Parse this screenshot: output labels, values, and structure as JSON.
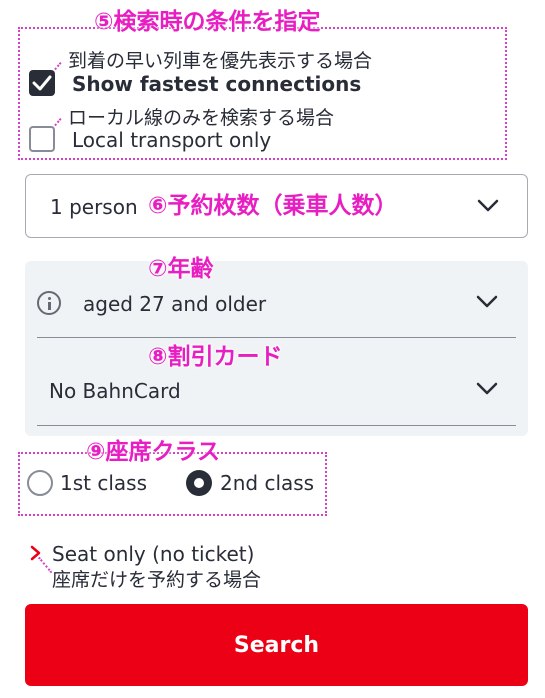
{
  "annotations": {
    "a5": "⑤検索時の条件を指定",
    "a6": "⑥予約枚数（乗車人数）",
    "a7": "⑦年齢",
    "a8": "⑧割引カード",
    "a9": "⑨座席クラス"
  },
  "options": {
    "fastest": {
      "note": "到着の早い列車を優先表示する場合",
      "label": "Show fastest connections",
      "checked": true
    },
    "local": {
      "note": "ローカル線のみを検索する場合",
      "label": "Local transport only",
      "checked": false
    }
  },
  "passengers": {
    "value": "1 person"
  },
  "traveller": {
    "age": "aged 27 and older",
    "discount_card": "No BahnCard"
  },
  "travel_class": {
    "options": [
      "1st class",
      "2nd class"
    ],
    "selected": "2nd class"
  },
  "seat_only": {
    "label": "Seat only (no ticket)",
    "note": "座席だけを予約する場合"
  },
  "search": {
    "label": "Search"
  },
  "colors": {
    "accent": "#ec0016",
    "annotation": "#e81ec2",
    "text": "#282d37"
  },
  "icons": [
    "check-icon",
    "chevron-down-icon",
    "info-icon",
    "chevron-right-icon"
  ]
}
